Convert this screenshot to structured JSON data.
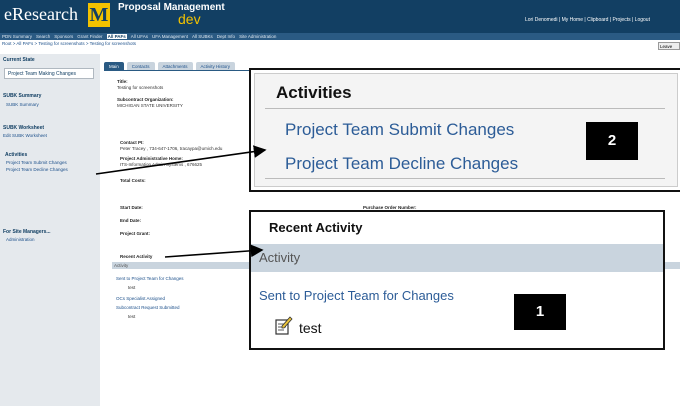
{
  "header": {
    "logo_text": "eResearch",
    "logo_m": "M",
    "app_title": "Proposal Management",
    "app_env": "dev",
    "user_links": "Lori Denomedi | My Home | Clipboard | Projects | Logout"
  },
  "nav": {
    "items": [
      "PDN Summary",
      "Search",
      "Sponsors",
      "Grant Finder",
      "All PAFs",
      "All UFAs",
      "UFA Management",
      "All SUBKs",
      "Dept Info",
      "Site Administration"
    ],
    "active_index": 4,
    "active_color": "#ffffff"
  },
  "breadcrumb": "Root > All PAFs > Testing for screenshots > Testing for screenshots",
  "leave_button": "Leave",
  "sidebar": {
    "current_state_label": "Current State",
    "current_state_value": "Project Team Making Changes",
    "subk_summary_head": "SUBK Summary",
    "subk_summary_link": "SUBK Summary",
    "subk_worksheet_head": "SUBK Worksheet",
    "edit_worksheet_link": "Edit SUBK Worksheet",
    "activities_head": "Activities",
    "activities": [
      "Project Team Submit Changes",
      "Project Team Decline Changes"
    ],
    "site_managers_head": "For Site Managers...",
    "administration_link": "Administration"
  },
  "main": {
    "tabs": [
      "Main",
      "Contacts",
      "Attachments",
      "Activity History"
    ],
    "active_tab": 0,
    "title_label": "Title:",
    "title_value": "Testing for screenshots",
    "subcontract_org_label": "Subcontract Organization:",
    "subcontract_org_value": "MICHIGAN STATE UNIVERSITY",
    "subk_id_label": "SUBK ID:",
    "subk_id_value": "000080",
    "parent_paf_label": "Parent PAF:",
    "parent_paf_value": "PAF00007",
    "contact_pi_label": "Contact PI:",
    "contact_pi_value": "Peter Tracey , 734-647-1706, tracaypa@umich.edu",
    "project_admin_label": "Project Administrative Home:",
    "project_admin_value": "ITS-Information Admin Systems , 676625",
    "total_costs_label": "Total Costs:",
    "start_date_label": "Start Date:",
    "end_date_label": "End Date:",
    "project_grant_label": "Project Grant:",
    "po_number_label": "Purchase Order Number:",
    "recent_activity_label": "Recent Activity",
    "activity_column": "Activity",
    "recent_items": [
      "Sent to Project Team for Changes",
      "test",
      "OCs Specialist Assigned",
      "Subcontract Request Submitted",
      "test"
    ]
  },
  "callouts": {
    "activities_title": "Activities",
    "activities_items": [
      "Project Team Submit Changes",
      "Project Team Decline Changes"
    ],
    "activities_badge": "2",
    "recent_title": "Recent Activity",
    "recent_band": "Activity",
    "recent_link": "Sent to Project Team for Changes",
    "recent_note": "test",
    "recent_badge": "1"
  }
}
